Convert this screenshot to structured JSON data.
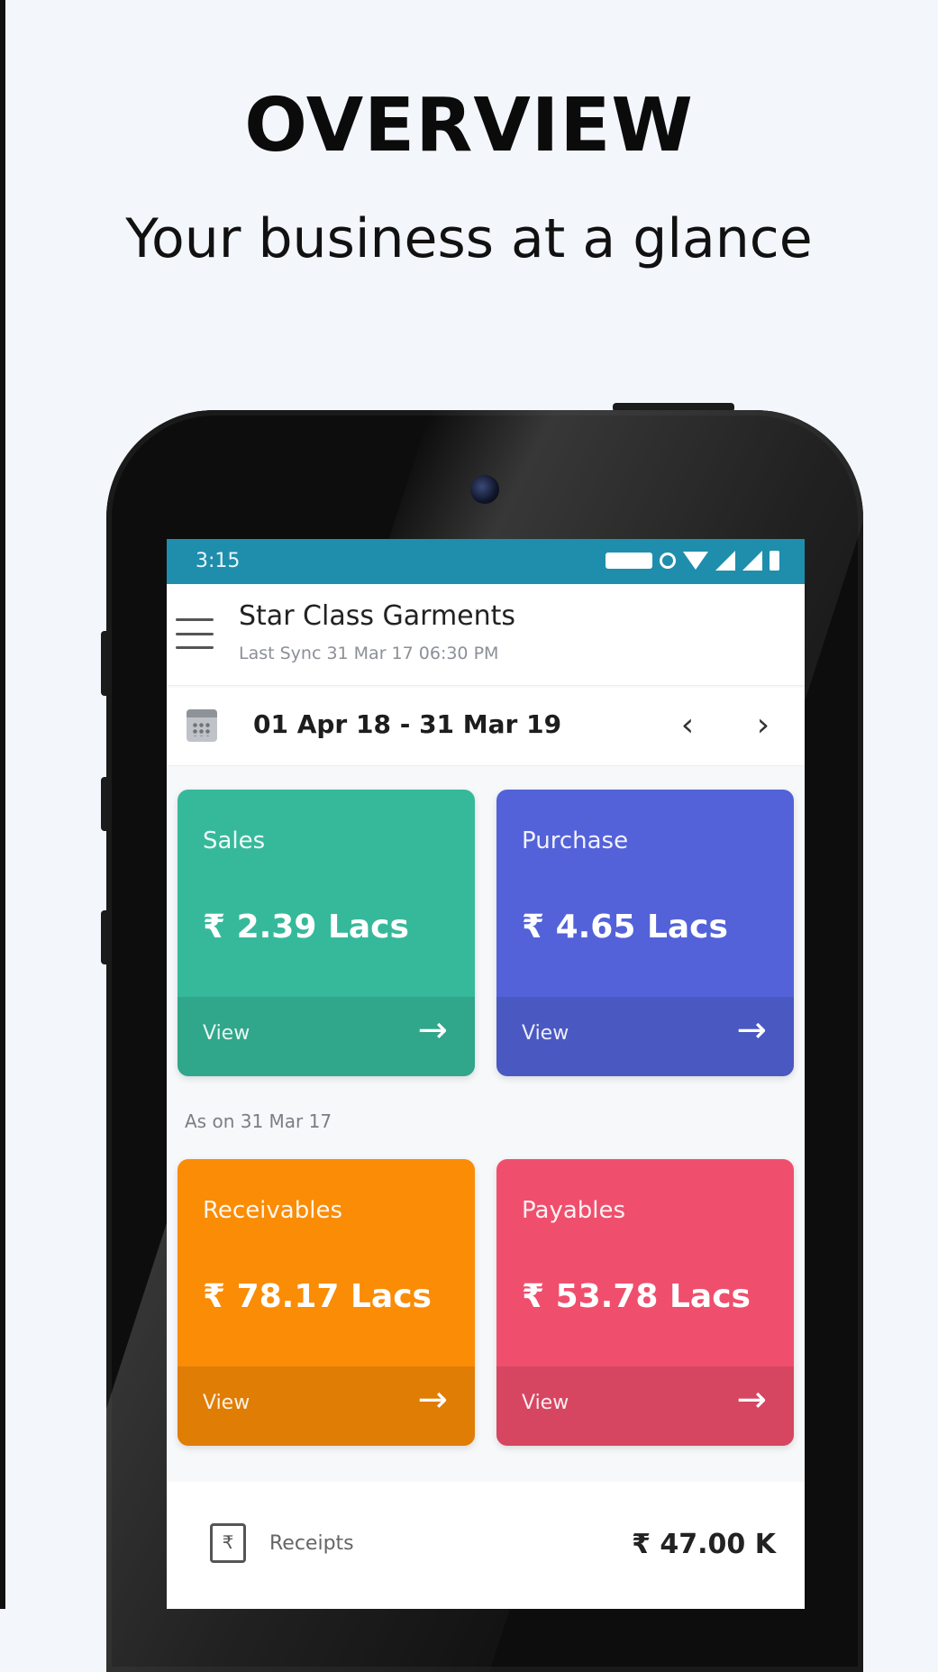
{
  "promo": {
    "title": "OVERVIEW",
    "subtitle": "Your business at a glance"
  },
  "status_bar": {
    "time": "3:15"
  },
  "header": {
    "company_name": "Star Class Garments",
    "last_sync": "Last Sync 31 Mar 17 06:30 PM"
  },
  "date_filter": {
    "range": "01 Apr 18 - 31 Mar 19",
    "prev_label": "‹",
    "next_label": "›"
  },
  "cards_top": [
    {
      "label": "Sales",
      "value": "₹ 2.39 Lacs",
      "view": "View",
      "color": "#36b99b"
    },
    {
      "label": "Purchase",
      "value": "₹ 4.65 Lacs",
      "view": "View",
      "color": "#5362d9"
    }
  ],
  "as_on": "As on 31 Mar 17",
  "cards_bottom": [
    {
      "label": "Receivables",
      "value": "₹ 78.17 Lacs",
      "view": "View",
      "color": "#fa8c06"
    },
    {
      "label": "Payables",
      "value": "₹ 53.78 Lacs",
      "view": "View",
      "color": "#ef4f6d"
    }
  ],
  "receipts": {
    "label": "Receipts",
    "value": "₹ 47.00 K",
    "icon_glyph": "₹"
  },
  "colors": {
    "status_bar": "#1f8eac",
    "background": "#f3f6fb"
  }
}
